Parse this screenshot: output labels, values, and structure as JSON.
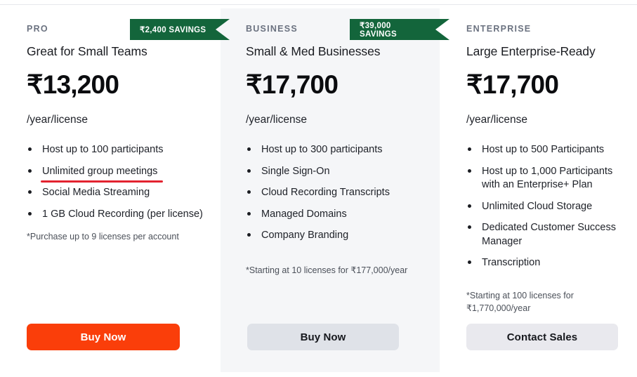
{
  "currency_symbol": "₹",
  "colors": {
    "primary_cta": "#fa3e0a",
    "secondary_cta": "#dfe2e8",
    "ribbon_green": "#13653b",
    "highlight_red": "#e32330",
    "middle_panel_bg": "#f5f6f8"
  },
  "plans": [
    {
      "tier": "PRO",
      "tagline": "Great for Small Teams",
      "price": "₹13,200",
      "period": "/year/license",
      "savings_badge": "₹2,400 SAVINGS",
      "features": [
        {
          "text": "Host up to 100 participants",
          "highlighted": false
        },
        {
          "text": "Unlimited group meetings",
          "highlighted": true
        },
        {
          "text": "Social Media Streaming",
          "highlighted": false
        },
        {
          "text": "1 GB Cloud Recording (per license)",
          "highlighted": false
        }
      ],
      "footnote": "*Purchase up to 9 licenses per account",
      "cta_label": "Buy Now"
    },
    {
      "tier": "BUSINESS",
      "tagline": "Small & Med Businesses",
      "price": "₹17,700",
      "period": "/year/license",
      "savings_badge": "₹39,000 SAVINGS",
      "features": [
        {
          "text": "Host up to 300 participants",
          "highlighted": false
        },
        {
          "text": "Single Sign-On",
          "highlighted": false
        },
        {
          "text": "Cloud Recording Transcripts",
          "highlighted": false
        },
        {
          "text": "Managed Domains",
          "highlighted": false
        },
        {
          "text": "Company Branding",
          "highlighted": false
        }
      ],
      "footnote": "*Starting at 10 licenses for ₹177,000/year",
      "cta_label": "Buy Now"
    },
    {
      "tier": "ENTERPRISE",
      "tagline": "Large Enterprise-Ready",
      "price": "₹17,700",
      "period": "/year/license",
      "savings_badge": "",
      "features": [
        {
          "text": "Host up to 500 Participants",
          "highlighted": false
        },
        {
          "text": "Host up to 1,000 Participants with an Enterprise+ Plan",
          "highlighted": false
        },
        {
          "text": "Unlimited Cloud Storage",
          "highlighted": false
        },
        {
          "text": "Dedicated Customer Success Manager",
          "highlighted": false
        },
        {
          "text": "Transcription",
          "highlighted": false
        }
      ],
      "footnote": "*Starting at 100 licenses for ₹1,770,000/year",
      "cta_label": "Contact Sales"
    }
  ]
}
